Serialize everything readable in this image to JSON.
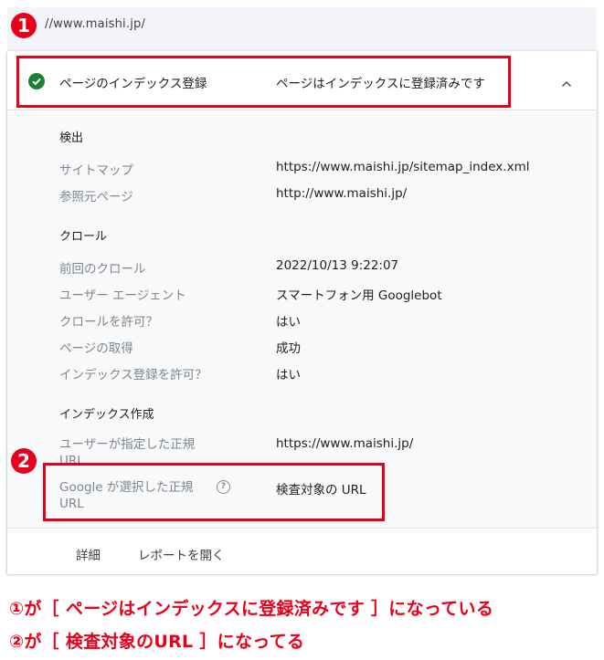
{
  "url_bar": {
    "url": "//www.maishi.jp/"
  },
  "markers": {
    "one": "1",
    "two": "2"
  },
  "card": {
    "header": {
      "label": "ページのインデックス登録",
      "status": "ページはインデックスに登録済みです",
      "status_color": "#188038"
    },
    "sections": {
      "discovery": {
        "title": "検出",
        "rows": [
          {
            "label": "サイトマップ",
            "value": "https://www.maishi.jp/sitemap_index.xml"
          },
          {
            "label": "参照元ページ",
            "value": "http://www.maishi.jp/"
          }
        ]
      },
      "crawl": {
        "title": "クロール",
        "rows": [
          {
            "label": "前回のクロール",
            "value": "2022/10/13 9:22:07"
          },
          {
            "label": "ユーザー エージェント",
            "value": "スマートフォン用 Googlebot"
          },
          {
            "label": "クロールを許可？",
            "value": "はい"
          },
          {
            "label": "ページの取得",
            "value": "成功"
          },
          {
            "label": "インデックス登録を許可？",
            "value": "はい"
          }
        ]
      },
      "indexing": {
        "title": "インデックス作成",
        "rows": [
          {
            "label": "ユーザーが指定した正規 URL",
            "value": "https://www.maishi.jp/"
          },
          {
            "label": "Google が選択した正規 URL",
            "value": "検査対象の URL"
          }
        ]
      }
    },
    "footer": {
      "details": "詳細",
      "open_report": "レポートを開く"
    }
  },
  "notes": {
    "line1": "①が［ ページはインデックスに登録済みです ］になっている",
    "line2": "②が［ 検査対象のURL ］になってる"
  },
  "accent_color": "#e8001a"
}
